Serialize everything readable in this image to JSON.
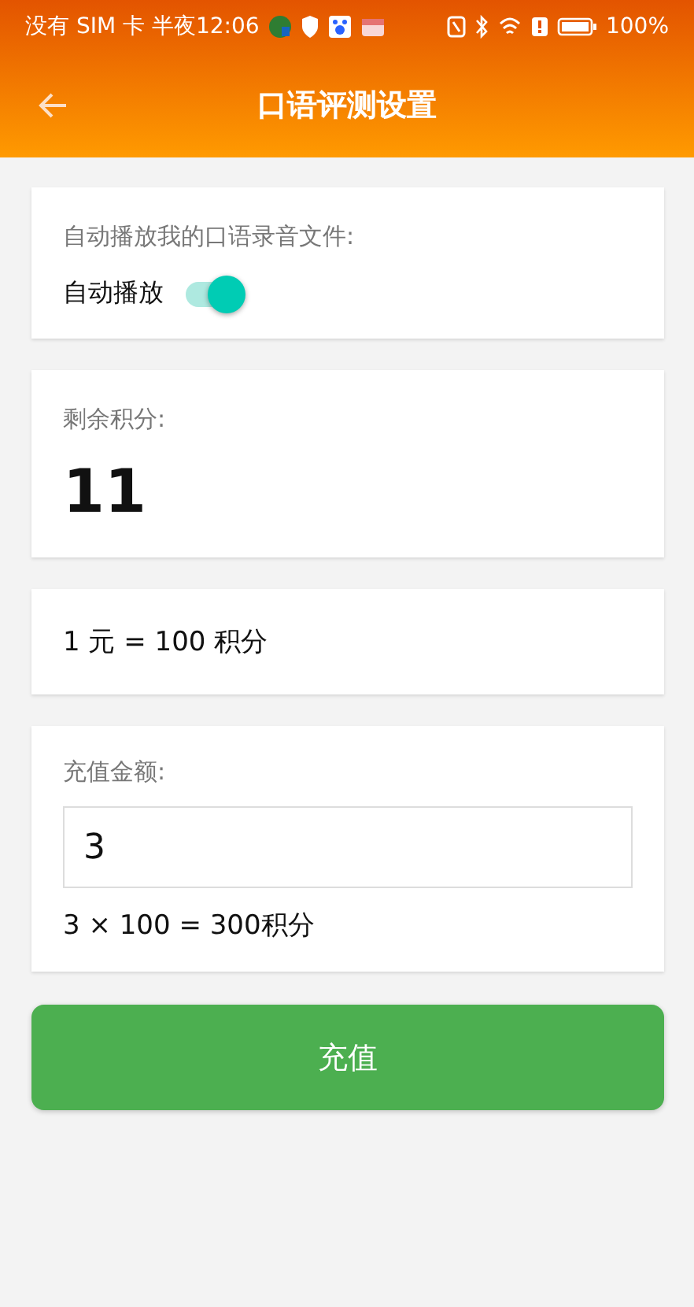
{
  "status_bar": {
    "carrier": "没有 SIM 卡 半夜12:06",
    "battery": "100%"
  },
  "header": {
    "title": "口语评测设置"
  },
  "autoplay_card": {
    "label": "自动播放我的口语录音文件:",
    "toggle_label": "自动播放",
    "on": true
  },
  "points_card": {
    "label": "剩余积分:",
    "value": "11"
  },
  "rate_card": {
    "text": "1 元 = 100 积分"
  },
  "recharge_card": {
    "label": "充值金额:",
    "amount": "3",
    "result": "3 × 100 = 300积分"
  },
  "recharge_button": "充值"
}
